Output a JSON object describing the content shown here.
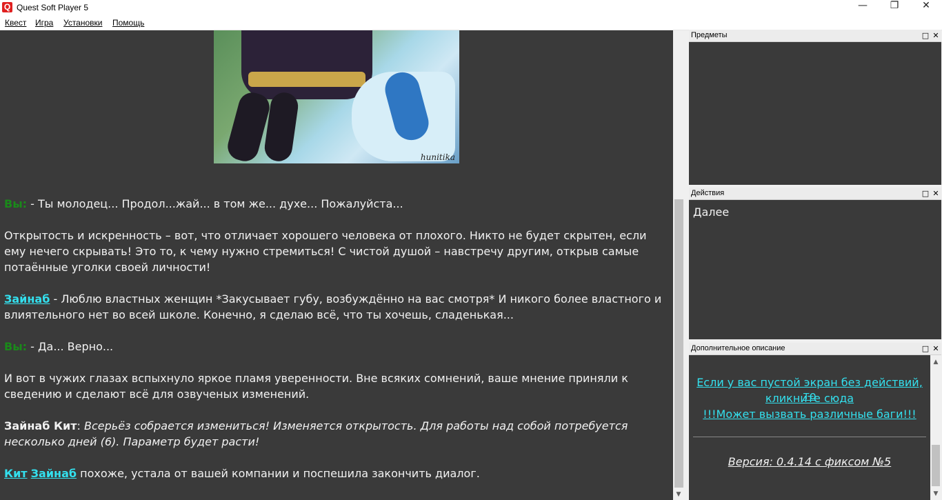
{
  "window": {
    "title": "Quest Soft Player 5",
    "icon_letter": "Q"
  },
  "window_buttons": {
    "minimize": "—",
    "restore": "❐",
    "close": "✕"
  },
  "menu": [
    "Квест",
    "Игра",
    "Установки",
    "Помощь"
  ],
  "picture": {
    "signature": "hunitika"
  },
  "story": {
    "line1_you": "Вы:",
    "line1_text": " - Ты молодец... Продол...жай... в том же... духе... Пожалуйста...",
    "para2": "Открытость и искренность – вот, что отличает хорошего человека от плохого. Никто не будет скрытен, если ему нечего скрывать! Это то, к чему нужно стремиться! С чистой душой – навстречу другим, открыв самые потаённые уголки своей личности!",
    "line3_name": "Зайнаб",
    "line3_text": "  - Люблю властных женщин *Закусывает губу, возбуждённо на вас смотря* И никого более властного и влиятельного нет во всей школе. Конечно, я сделаю всё, что ты хочешь, сладенькая...",
    "line4_you": "Вы:",
    "line4_text": " - Да... Верно...",
    "para5": "И вот в чужих глазах вспыхнуло яркое пламя уверенности. Вне всяких сомнений, ваше мнение приняли к сведению и сделают всё для озвученых изменений.",
    "line6_bold": "Зайнаб Кит",
    "line6_colon": ": ",
    "line6_italic": "Всерьёз собрается измениться! Изменяется  открытость. Для  работы над собой потребуется несколько дней (6). Параметр будет расти!",
    "line7_name1": "Кит",
    "line7_name2": "Зайнаб",
    "line7_text": " похоже, устала от вашей компании и поспешила закончить диалог."
  },
  "panels": {
    "items": {
      "title": "Предметы"
    },
    "actions": {
      "title": "Действия",
      "list": [
        "Далее"
      ]
    },
    "description": {
      "title": "Дополнительное описание",
      "link_line1": "Если у вас пустой экран без действий, то",
      "link_line2": "кликните сюда",
      "warning": "!!!Может вызвать различные баги!!!",
      "version": "Версия: 0.4.14 с фиксом №5"
    },
    "btn_max": "□",
    "btn_close": "✕"
  }
}
